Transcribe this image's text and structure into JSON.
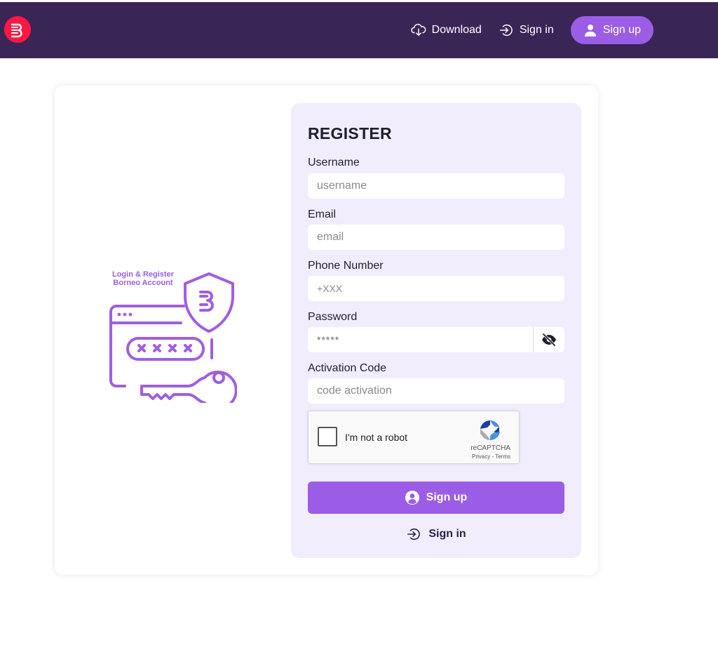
{
  "header": {
    "download_label": "Download",
    "signin_label": "Sign in",
    "signup_label": "Sign up"
  },
  "illustration": {
    "title_line1": "Login & Register",
    "title_line2": "Borneo Account"
  },
  "form": {
    "heading": "REGISTER",
    "username": {
      "label": "Username",
      "placeholder": "username",
      "value": ""
    },
    "email": {
      "label": "Email",
      "placeholder": "email",
      "value": ""
    },
    "phone": {
      "label": "Phone Number",
      "placeholder": "+XXX",
      "value": ""
    },
    "password": {
      "label": "Password",
      "placeholder": "*****",
      "value": ""
    },
    "activation": {
      "label": "Activation Code",
      "placeholder": "code activation",
      "value": ""
    },
    "captcha": {
      "label": "I'm not a robot",
      "brand": "reCAPTCHA",
      "privacy": "Privacy",
      "separator": " - ",
      "terms": "Terms"
    },
    "submit_label": "Sign up",
    "signin_label": "Sign in"
  },
  "colors": {
    "header_bg": "#3a2557",
    "accent": "#9b5de5",
    "panel_bg": "#f1edfd",
    "logo_red": "#ff1744"
  }
}
